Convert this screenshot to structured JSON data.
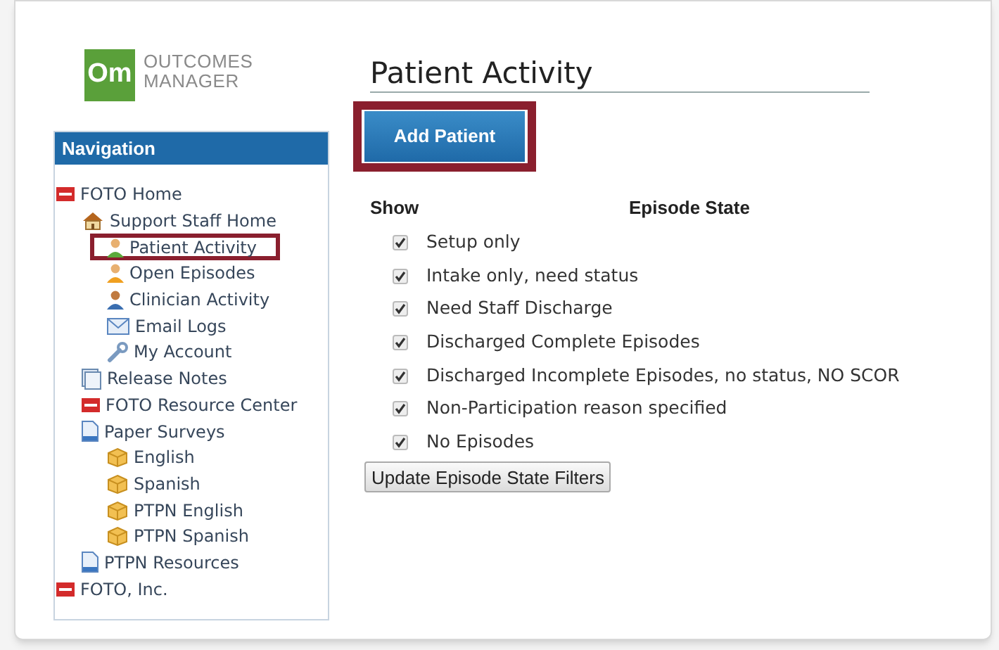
{
  "logo": {
    "mark": "Om",
    "name_line_1": "OUTCOMES",
    "name_line_2": "MANAGER"
  },
  "navigation": {
    "title": "Navigation",
    "items": [
      {
        "label": "FOTO Home",
        "kind": "foto",
        "highlighted": false,
        "children": [
          {
            "label": "Support Staff Home",
            "kind": "home",
            "highlighted": false,
            "children": [
              {
                "label": "Patient Activity",
                "kind": "person-green",
                "highlighted": true
              },
              {
                "label": "Open Episodes",
                "kind": "person-orange",
                "highlighted": false
              },
              {
                "label": "Clinician Activity",
                "kind": "person-blue",
                "highlighted": false
              },
              {
                "label": "Email Logs",
                "kind": "mail",
                "highlighted": false
              },
              {
                "label": "My Account",
                "kind": "wrench",
                "highlighted": false
              }
            ]
          },
          {
            "label": "Release Notes",
            "kind": "notes",
            "highlighted": false
          },
          {
            "label": "FOTO Resource Center",
            "kind": "foto",
            "highlighted": false
          },
          {
            "label": "Paper Surveys",
            "kind": "doc",
            "highlighted": false,
            "children": [
              {
                "label": "English",
                "kind": "box",
                "highlighted": false
              },
              {
                "label": "Spanish",
                "kind": "box",
                "highlighted": false
              },
              {
                "label": "PTPN English",
                "kind": "box",
                "highlighted": false
              },
              {
                "label": "PTPN Spanish",
                "kind": "box",
                "highlighted": false
              }
            ]
          },
          {
            "label": "PTPN Resources",
            "kind": "doc",
            "highlighted": false
          }
        ]
      },
      {
        "label": "FOTO, Inc.",
        "kind": "foto",
        "highlighted": false
      }
    ]
  },
  "page_title": "Patient Activity",
  "add_button": {
    "label": "Add Patient",
    "highlighted": true
  },
  "filters": {
    "columns": [
      "Show",
      "Episode State"
    ],
    "rows": [
      {
        "label": "Setup only",
        "checked": true
      },
      {
        "label": "Intake only, need status",
        "checked": true
      },
      {
        "label": "Need Staff Discharge",
        "checked": true
      },
      {
        "label": "Discharged Complete Episodes",
        "checked": true
      },
      {
        "label": "Discharged Incomplete Episodes, no status, NO SCOR",
        "checked": true
      },
      {
        "label": "Non-Participation reason specified",
        "checked": true
      },
      {
        "label": "No Episodes",
        "checked": true
      }
    ]
  },
  "update_button": "Update Episode State Filters"
}
